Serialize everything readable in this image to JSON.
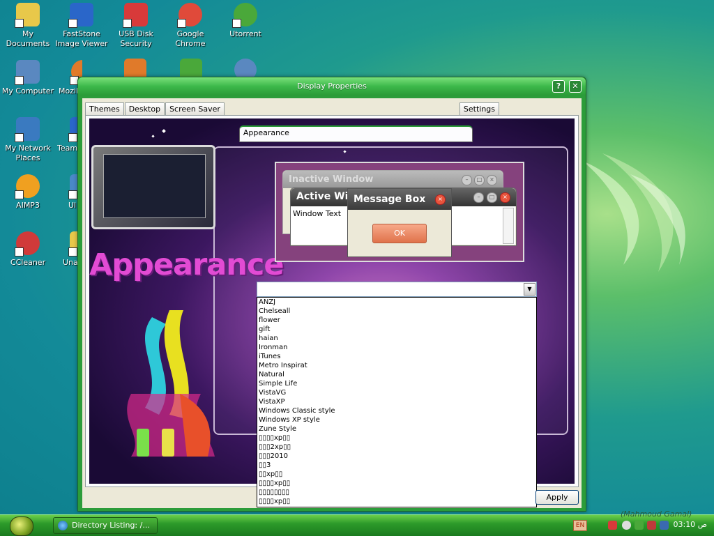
{
  "desktop": {
    "icons": [
      {
        "label": "My Documents",
        "color": "#e8c84a"
      },
      {
        "label": "FastStone Image Viewer",
        "color": "#2a66c9"
      },
      {
        "label": "USB Disk Security",
        "color": "#d83a3a"
      },
      {
        "label": "Google Chrome",
        "color": "#e04a3a"
      },
      {
        "label": "Utorrent",
        "color": "#4aa83a"
      },
      {
        "label": "My Computer",
        "color": "#5a88c0"
      },
      {
        "label": "Mozill",
        "color": "#e07a2a"
      },
      {
        "label": "My Network Places",
        "color": "#3a7ac0"
      },
      {
        "label": "Team",
        "color": "#2a66c9"
      },
      {
        "label": "AIMP3",
        "color": "#f0a020"
      },
      {
        "label": "Ul",
        "color": "#4a88c8"
      },
      {
        "label": "CCleaner",
        "color": "#d03a3a"
      },
      {
        "label": "Una",
        "color": "#e8c84a"
      }
    ]
  },
  "window": {
    "title": "Display Properties",
    "help_label": "?",
    "close_label": "✕",
    "tabs": [
      "Themes",
      "Desktop",
      "Screen Saver",
      "Appearance",
      "Settings"
    ],
    "active_tab": "Appearance",
    "apply_label": "Apply"
  },
  "scene": {
    "title": "Appearance"
  },
  "preview": {
    "inactive_title": "Inactive Window",
    "active_title": "Active Win",
    "window_text": "Window Text",
    "message_title": "Message Box",
    "ok_label": "OK"
  },
  "combo": {
    "selected": "",
    "items": [
      "ANZJ",
      "Chelseall",
      "flower",
      "gift",
      "haian",
      "Ironman",
      "iTunes",
      "Metro Inspirat",
      "Natural",
      "Simple Life",
      "VistaVG",
      "VistaXP",
      "Windows Classic style",
      "Windows XP style",
      "Zune Style",
      "▯▯▯▯xp▯▯",
      "▯▯▯2xp▯▯",
      "▯▯▯2010",
      "▯▯3",
      "▯▯xp▯▯",
      "▯▯▯▯xp▯▯",
      "▯▯▯▯▯▯▯▯",
      "▯▯▯▯xp▯▯"
    ]
  },
  "taskbar": {
    "task_label": "Directory Listing: /...",
    "lang": "EN",
    "clock": "03:10 ص",
    "watermark": "(Mahmoud Gamal)"
  }
}
